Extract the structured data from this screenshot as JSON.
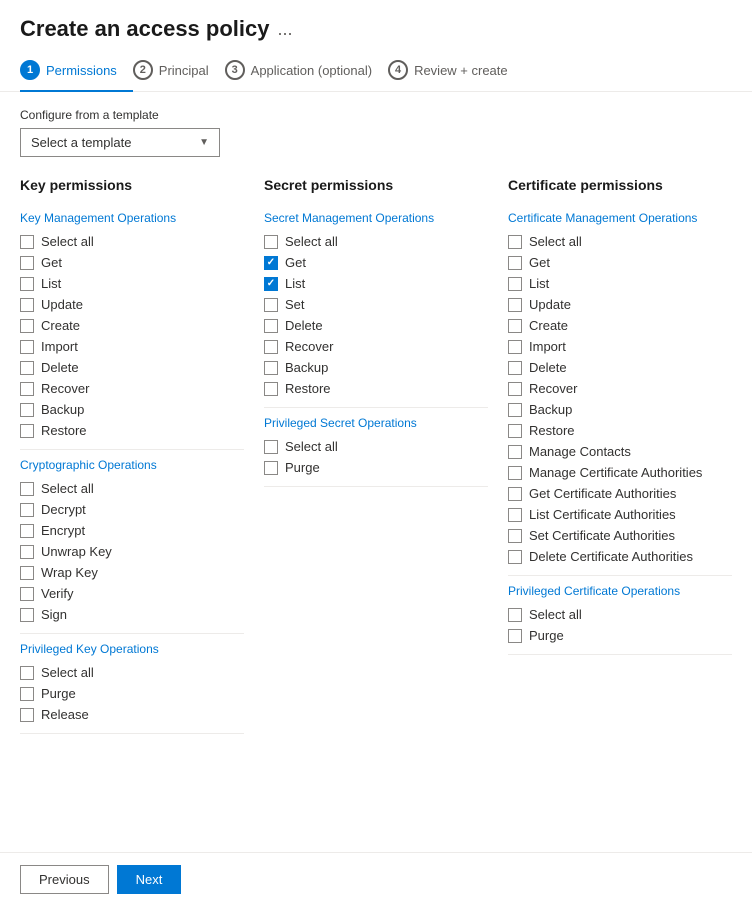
{
  "header": {
    "title": "Create an access policy",
    "ellipsis": "..."
  },
  "tabs": [
    {
      "id": "permissions",
      "number": "1",
      "label": "Permissions",
      "active": true
    },
    {
      "id": "principal",
      "number": "2",
      "label": "Principal",
      "active": false
    },
    {
      "id": "application",
      "number": "3",
      "label": "Application (optional)",
      "active": false
    },
    {
      "id": "review",
      "number": "4",
      "label": "Review + create",
      "active": false
    }
  ],
  "configure_label": "Configure from a template",
  "template_placeholder": "Select a template",
  "columns": {
    "key": {
      "header": "Key permissions",
      "sections": [
        {
          "label": "Key Management Operations",
          "items": [
            {
              "label": "Select all",
              "checked": false
            },
            {
              "label": "Get",
              "checked": false
            },
            {
              "label": "List",
              "checked": false
            },
            {
              "label": "Update",
              "checked": false
            },
            {
              "label": "Create",
              "checked": false
            },
            {
              "label": "Import",
              "checked": false
            },
            {
              "label": "Delete",
              "checked": false
            },
            {
              "label": "Recover",
              "checked": false
            },
            {
              "label": "Backup",
              "checked": false
            },
            {
              "label": "Restore",
              "checked": false
            }
          ]
        },
        {
          "label": "Cryptographic Operations",
          "items": [
            {
              "label": "Select all",
              "checked": false
            },
            {
              "label": "Decrypt",
              "checked": false
            },
            {
              "label": "Encrypt",
              "checked": false
            },
            {
              "label": "Unwrap Key",
              "checked": false
            },
            {
              "label": "Wrap Key",
              "checked": false
            },
            {
              "label": "Verify",
              "checked": false
            },
            {
              "label": "Sign",
              "checked": false
            }
          ]
        },
        {
          "label": "Privileged Key Operations",
          "items": [
            {
              "label": "Select all",
              "checked": false
            },
            {
              "label": "Purge",
              "checked": false
            },
            {
              "label": "Release",
              "checked": false
            }
          ]
        }
      ]
    },
    "secret": {
      "header": "Secret permissions",
      "sections": [
        {
          "label": "Secret Management Operations",
          "items": [
            {
              "label": "Select all",
              "checked": false
            },
            {
              "label": "Get",
              "checked": true
            },
            {
              "label": "List",
              "checked": true
            },
            {
              "label": "Set",
              "checked": false
            },
            {
              "label": "Delete",
              "checked": false
            },
            {
              "label": "Recover",
              "checked": false
            },
            {
              "label": "Backup",
              "checked": false
            },
            {
              "label": "Restore",
              "checked": false
            }
          ]
        },
        {
          "label": "Privileged Secret Operations",
          "items": [
            {
              "label": "Select all",
              "checked": false
            },
            {
              "label": "Purge",
              "checked": false
            }
          ]
        }
      ]
    },
    "certificate": {
      "header": "Certificate permissions",
      "sections": [
        {
          "label": "Certificate Management Operations",
          "items": [
            {
              "label": "Select all",
              "checked": false
            },
            {
              "label": "Get",
              "checked": false
            },
            {
              "label": "List",
              "checked": false
            },
            {
              "label": "Update",
              "checked": false
            },
            {
              "label": "Create",
              "checked": false
            },
            {
              "label": "Import",
              "checked": false
            },
            {
              "label": "Delete",
              "checked": false
            },
            {
              "label": "Recover",
              "checked": false
            },
            {
              "label": "Backup",
              "checked": false
            },
            {
              "label": "Restore",
              "checked": false
            },
            {
              "label": "Manage Contacts",
              "checked": false
            },
            {
              "label": "Manage Certificate Authorities",
              "checked": false
            },
            {
              "label": "Get Certificate Authorities",
              "checked": false
            },
            {
              "label": "List Certificate Authorities",
              "checked": false
            },
            {
              "label": "Set Certificate Authorities",
              "checked": false
            },
            {
              "label": "Delete Certificate Authorities",
              "checked": false
            }
          ]
        },
        {
          "label": "Privileged Certificate Operations",
          "items": [
            {
              "label": "Select all",
              "checked": false
            },
            {
              "label": "Purge",
              "checked": false
            }
          ]
        }
      ]
    }
  },
  "footer": {
    "previous_label": "Previous",
    "next_label": "Next"
  }
}
